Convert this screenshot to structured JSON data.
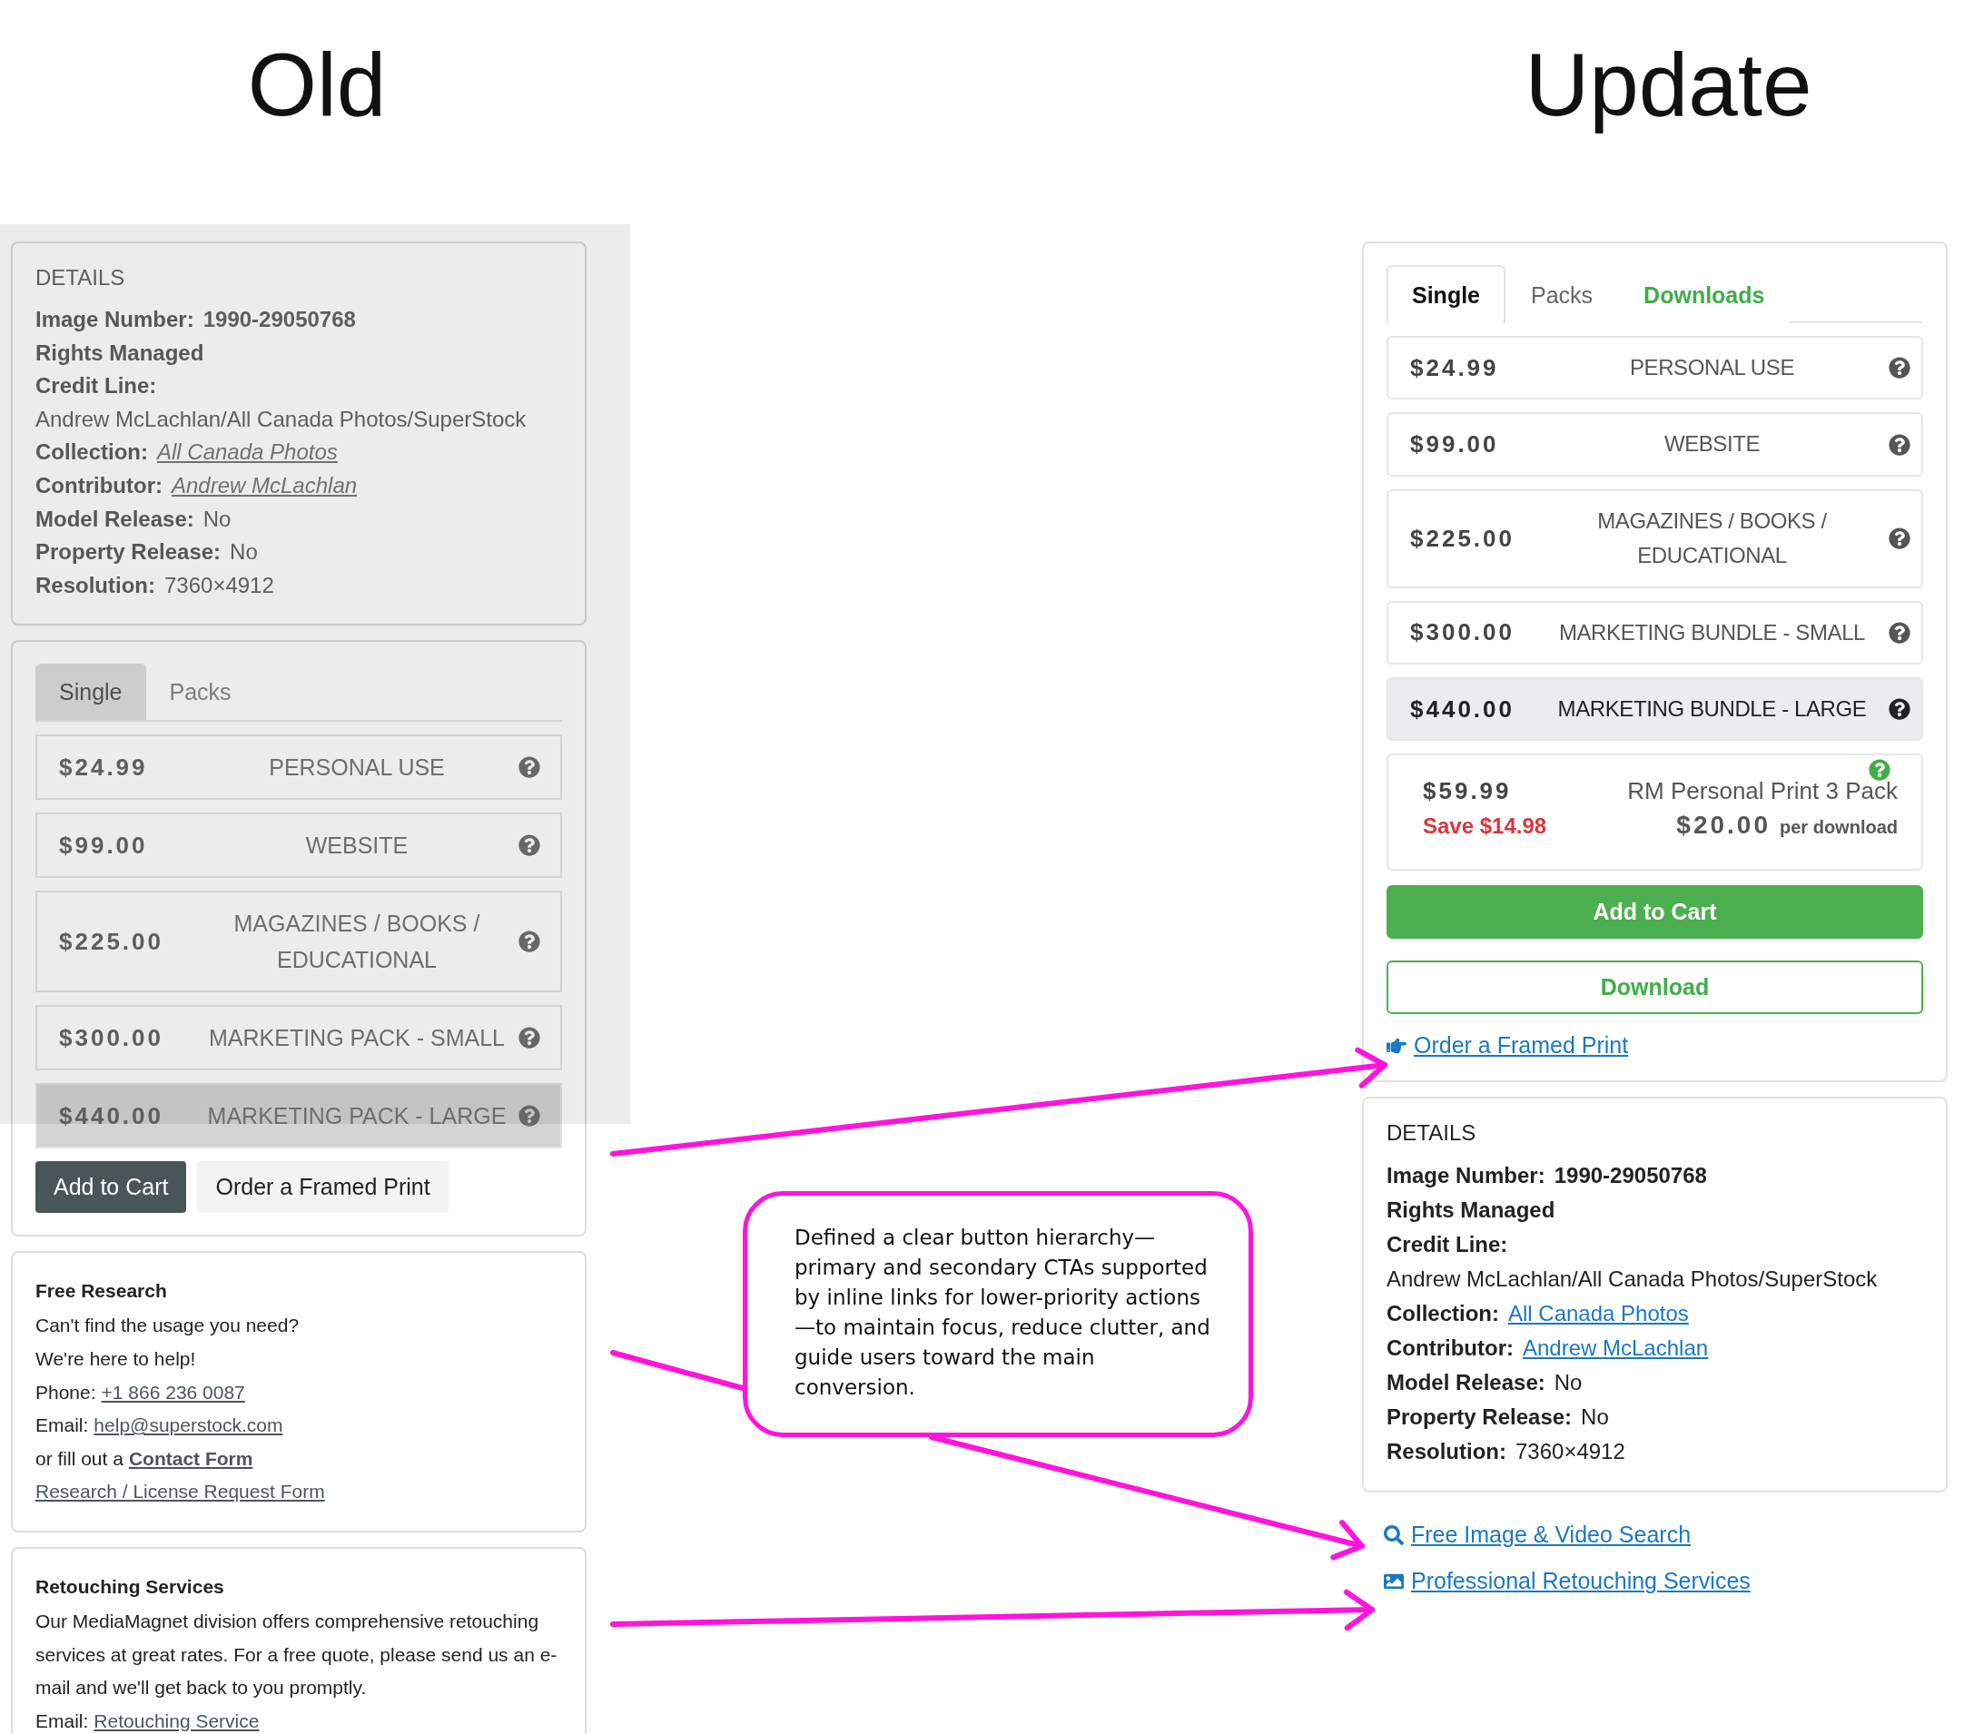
{
  "old": {
    "title": "Old",
    "details": {
      "heading": "DETAILS",
      "lines": [
        {
          "label": "Image Number:",
          "value": "1990-29050768",
          "kind": "bold"
        },
        {
          "label": "Rights Managed"
        },
        {
          "label": "Credit Line:"
        },
        {
          "value": "Andrew McLachlan/All Canada Photos/SuperStock",
          "kind": "plain"
        },
        {
          "label": "Collection:",
          "value": "All Canada Photos",
          "kind": "link"
        },
        {
          "label": "Contributor:",
          "value": "Andrew McLachlan",
          "kind": "link"
        },
        {
          "label": "Model Release:",
          "value": "No",
          "kind": "plain"
        },
        {
          "label": "Property Release:",
          "value": "No",
          "kind": "plain"
        },
        {
          "label": "Resolution:",
          "value": "7360×4912",
          "kind": "plain"
        }
      ]
    },
    "tabs": [
      {
        "label": "Single",
        "selected": true
      },
      {
        "label": "Packs",
        "selected": false
      }
    ],
    "prices": [
      {
        "kind": "license",
        "price": "$24.99",
        "label": "PERSONAL USE",
        "selected": false
      },
      {
        "kind": "license",
        "price": "$99.00",
        "label": "WEBSITE",
        "selected": false
      },
      {
        "kind": "license",
        "price": "$225.00",
        "label": "MAGAZINES / BOOKS / EDUCATIONAL",
        "selected": false
      },
      {
        "kind": "license",
        "price": "$300.00",
        "label": "MARKETING PACK - SMALL",
        "selected": false
      },
      {
        "kind": "license",
        "price": "$440.00",
        "label": "MARKETING PACK - LARGE",
        "selected": true
      }
    ],
    "buttons": [
      {
        "label": "Add to Cart",
        "kind": "primary"
      },
      {
        "label": "Order a Framed Print",
        "kind": "secondary"
      }
    ],
    "free_research": {
      "title": "Free Research",
      "lines": [
        {
          "text": "Can't find the usage you need?"
        },
        {
          "text": "We're here to help!"
        },
        {
          "text": "Phone:",
          "link": "+1 866 236 0087",
          "bold": false
        },
        {
          "text": "Email:",
          "link": "help@superstock.com",
          "bold": false
        },
        {
          "text": "or fill out a",
          "link": "Contact Form",
          "bold": true
        },
        {
          "link": "Research / License Request Form",
          "bold": false
        }
      ]
    },
    "retouching": {
      "title": "Retouching Services",
      "body": "Our MediaMagnet division offers comprehensive retouching services at great rates. For a free quote, please send us an e-mail and we'll get back to you promptly.",
      "email_label": "Email:",
      "email_link": "Retouching Service"
    }
  },
  "update": {
    "title": "Update",
    "tabs": [
      {
        "label": "Single",
        "selected": true,
        "featured": false
      },
      {
        "label": "Packs",
        "selected": false,
        "featured": false
      },
      {
        "label": "Downloads",
        "selected": false,
        "featured": true
      }
    ],
    "prices": [
      {
        "kind": "license",
        "price": "$24.99",
        "label": "PERSONAL USE",
        "selected": false
      },
      {
        "kind": "license",
        "price": "$99.00",
        "label": "WEBSITE",
        "selected": false
      },
      {
        "kind": "license",
        "price": "$225.00",
        "label": "MAGAZINES / BOOKS / EDUCATIONAL",
        "selected": false
      },
      {
        "kind": "license",
        "price": "$300.00",
        "label": "MARKETING BUNDLE - SMALL",
        "selected": false
      },
      {
        "kind": "license",
        "price": "$440.00",
        "label": "MARKETING BUNDLE - LARGE",
        "selected": true
      },
      {
        "kind": "pack",
        "price": "$59.99",
        "save": "Save $14.98",
        "label": "RM Personal Print 3 Pack",
        "unit_price": "$20.00",
        "unit_label": "per download",
        "selected": false
      }
    ],
    "buttons": [
      {
        "label": "Add to Cart",
        "kind": "primary"
      },
      {
        "label": "Download",
        "kind": "outline"
      }
    ],
    "order_link": "Order a Framed Print",
    "details": {
      "heading": "DETAILS",
      "lines": [
        {
          "label": "Image Number:",
          "value": "1990-29050768",
          "kind": "bold"
        },
        {
          "label": "Rights Managed"
        },
        {
          "label": "Credit Line:"
        },
        {
          "value": "Andrew McLachlan/All Canada Photos/SuperStock",
          "kind": "plain"
        },
        {
          "label": "Collection:",
          "value": "All Canada Photos",
          "kind": "link"
        },
        {
          "label": "Contributor:",
          "value": "Andrew McLachlan",
          "kind": "link"
        },
        {
          "label": "Model Release:",
          "value": "No",
          "kind": "plain"
        },
        {
          "label": "Property Release:",
          "value": "No",
          "kind": "plain"
        },
        {
          "label": "Resolution:",
          "value": "7360×4912",
          "kind": "plain"
        }
      ]
    },
    "links": [
      {
        "label": "Free Image & Video Search"
      },
      {
        "label": "Professional Retouching Services"
      }
    ]
  },
  "callout": "Defined a clear button hierarchy—primary and secondary CTAs supported by inline links for lower-priority actions—to maintain focus, reduce clutter, and guide users toward the main conversion."
}
